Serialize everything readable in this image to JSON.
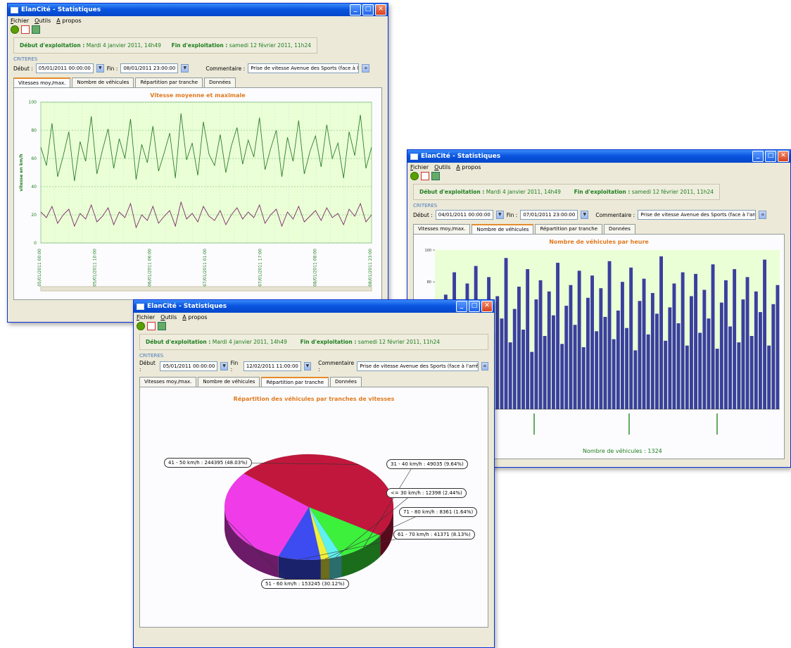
{
  "app": {
    "title": "ElanCité - Statistiques",
    "menu": [
      "Fichier",
      "Outils",
      "A propos"
    ]
  },
  "info": {
    "debut_label": "Début d'exploitation :",
    "debut_value": "Mardi 4 janvier 2011, 14h49",
    "fin_label": "Fin d'exploitation :",
    "fin_value": "samedi 12 février 2011, 11h24"
  },
  "criteres": {
    "label": "CRITERES",
    "debut_label": "Début :",
    "fin_label": "Fin :",
    "commentaire_label": "Commentaire :",
    "commentaire_value": "Prise de vitesse Avenue des Sports (face à l'arrêt de bus)"
  },
  "tabs": [
    "Vitesses moy./max.",
    "Nombre de véhicules",
    "Répartition par tranche",
    "Données"
  ],
  "window1": {
    "debut_value": "05/01/2011 00:00:00",
    "fin_value": "08/01/2011 23:00:00",
    "active_tab": 0,
    "chart_data": {
      "type": "line",
      "title": "Vitesse moyenne et maximale",
      "ylabel": "vitesse en km/h",
      "ylim": [
        0,
        100
      ],
      "y_ticks": [
        "100",
        "80",
        "60",
        "40",
        "20",
        "0"
      ],
      "x_ticks": [
        "05/01/2011 00:00",
        "05/01/2011 10:00",
        "06/01/2011 06:00",
        "07/01/2011 01:00",
        "07/01/2011 17:00",
        "08/01/2011 08:00",
        "08/01/2011 23:00"
      ],
      "series": [
        {
          "color": "#2e7d2e",
          "values": [
            68,
            55,
            85,
            47,
            62,
            79,
            44,
            72,
            58,
            90,
            49,
            66,
            81,
            53,
            74,
            60,
            88,
            45,
            70,
            57,
            83,
            51,
            64,
            78,
            46,
            92,
            59,
            71,
            48,
            86,
            63,
            55,
            77,
            50,
            69,
            82,
            56,
            73,
            61,
            89,
            52,
            67,
            80,
            47,
            75,
            58,
            87,
            49,
            65,
            76,
            54,
            84,
            60,
            71,
            46,
            79,
            62,
            91,
            53,
            68
          ]
        },
        {
          "color": "#7a2a6a",
          "values": [
            22,
            18,
            26,
            14,
            20,
            24,
            12,
            21,
            17,
            27,
            15,
            19,
            25,
            13,
            22,
            18,
            28,
            11,
            20,
            16,
            26,
            14,
            19,
            23,
            12,
            29,
            17,
            21,
            15,
            26,
            19,
            16,
            23,
            13,
            20,
            25,
            17,
            22,
            18,
            27,
            14,
            20,
            24,
            12,
            22,
            17,
            26,
            15,
            19,
            23,
            16,
            25,
            18,
            21,
            13,
            24,
            19,
            28,
            15,
            20
          ]
        }
      ]
    }
  },
  "window2": {
    "debut_value": "04/01/2011 00:00:00",
    "fin_value": "07/01/2011 23:00:00",
    "active_tab": 1,
    "footer": "Nombre de véhicules : 1324",
    "chart_data": {
      "type": "bar",
      "title": "Nombre de véhicules par heure",
      "ylim": [
        0,
        100
      ],
      "y_ticks": [
        "100",
        "80"
      ],
      "values": [
        40,
        55,
        72,
        38,
        86,
        61,
        45,
        79,
        52,
        90,
        34,
        66,
        83,
        48,
        71,
        57,
        95,
        42,
        63,
        77,
        50,
        88,
        36,
        69,
        81,
        46,
        74,
        59,
        92,
        41,
        65,
        78,
        53,
        87,
        39,
        70,
        84,
        49,
        76,
        58,
        93,
        44,
        62,
        80,
        51,
        89,
        37,
        68,
        82,
        47,
        73,
        60,
        96,
        43,
        64,
        79,
        54,
        86,
        40,
        71,
        85,
        48,
        75,
        57,
        91,
        38,
        67,
        81,
        52,
        88,
        42,
        69,
        83,
        46,
        74,
        61,
        94,
        40,
        66,
        78
      ]
    }
  },
  "window3": {
    "debut_value": "05/01/2011 00:00:00",
    "fin_value": "12/02/2011 11:00:00",
    "active_tab": 2,
    "chart_data": {
      "type": "pie",
      "title": "Répartition des véhicules par tranches de vitesses",
      "slices": [
        {
          "label": "41 - 50 km/h : 244395 (48.03%)",
          "value": 48.03,
          "color": "#c2173c"
        },
        {
          "label": "31 - 40 km/h : 49035 (9.64%)",
          "value": 9.64,
          "color": "#3cf03c"
        },
        {
          "label": "<= 30 km/h : 12398 (2.44%)",
          "value": 2.44,
          "color": "#5ff0f0"
        },
        {
          "label": "71 - 80 km/h : 8361 (1.64%)",
          "value": 1.64,
          "color": "#f0f03c"
        },
        {
          "label": "61 - 70 km/h : 41371 (8.13%)",
          "value": 8.13,
          "color": "#3c4cf0"
        },
        {
          "label": "51 - 60 km/h : 153245 (30.12%)",
          "value": 30.12,
          "color": "#f03ce8"
        }
      ]
    }
  }
}
